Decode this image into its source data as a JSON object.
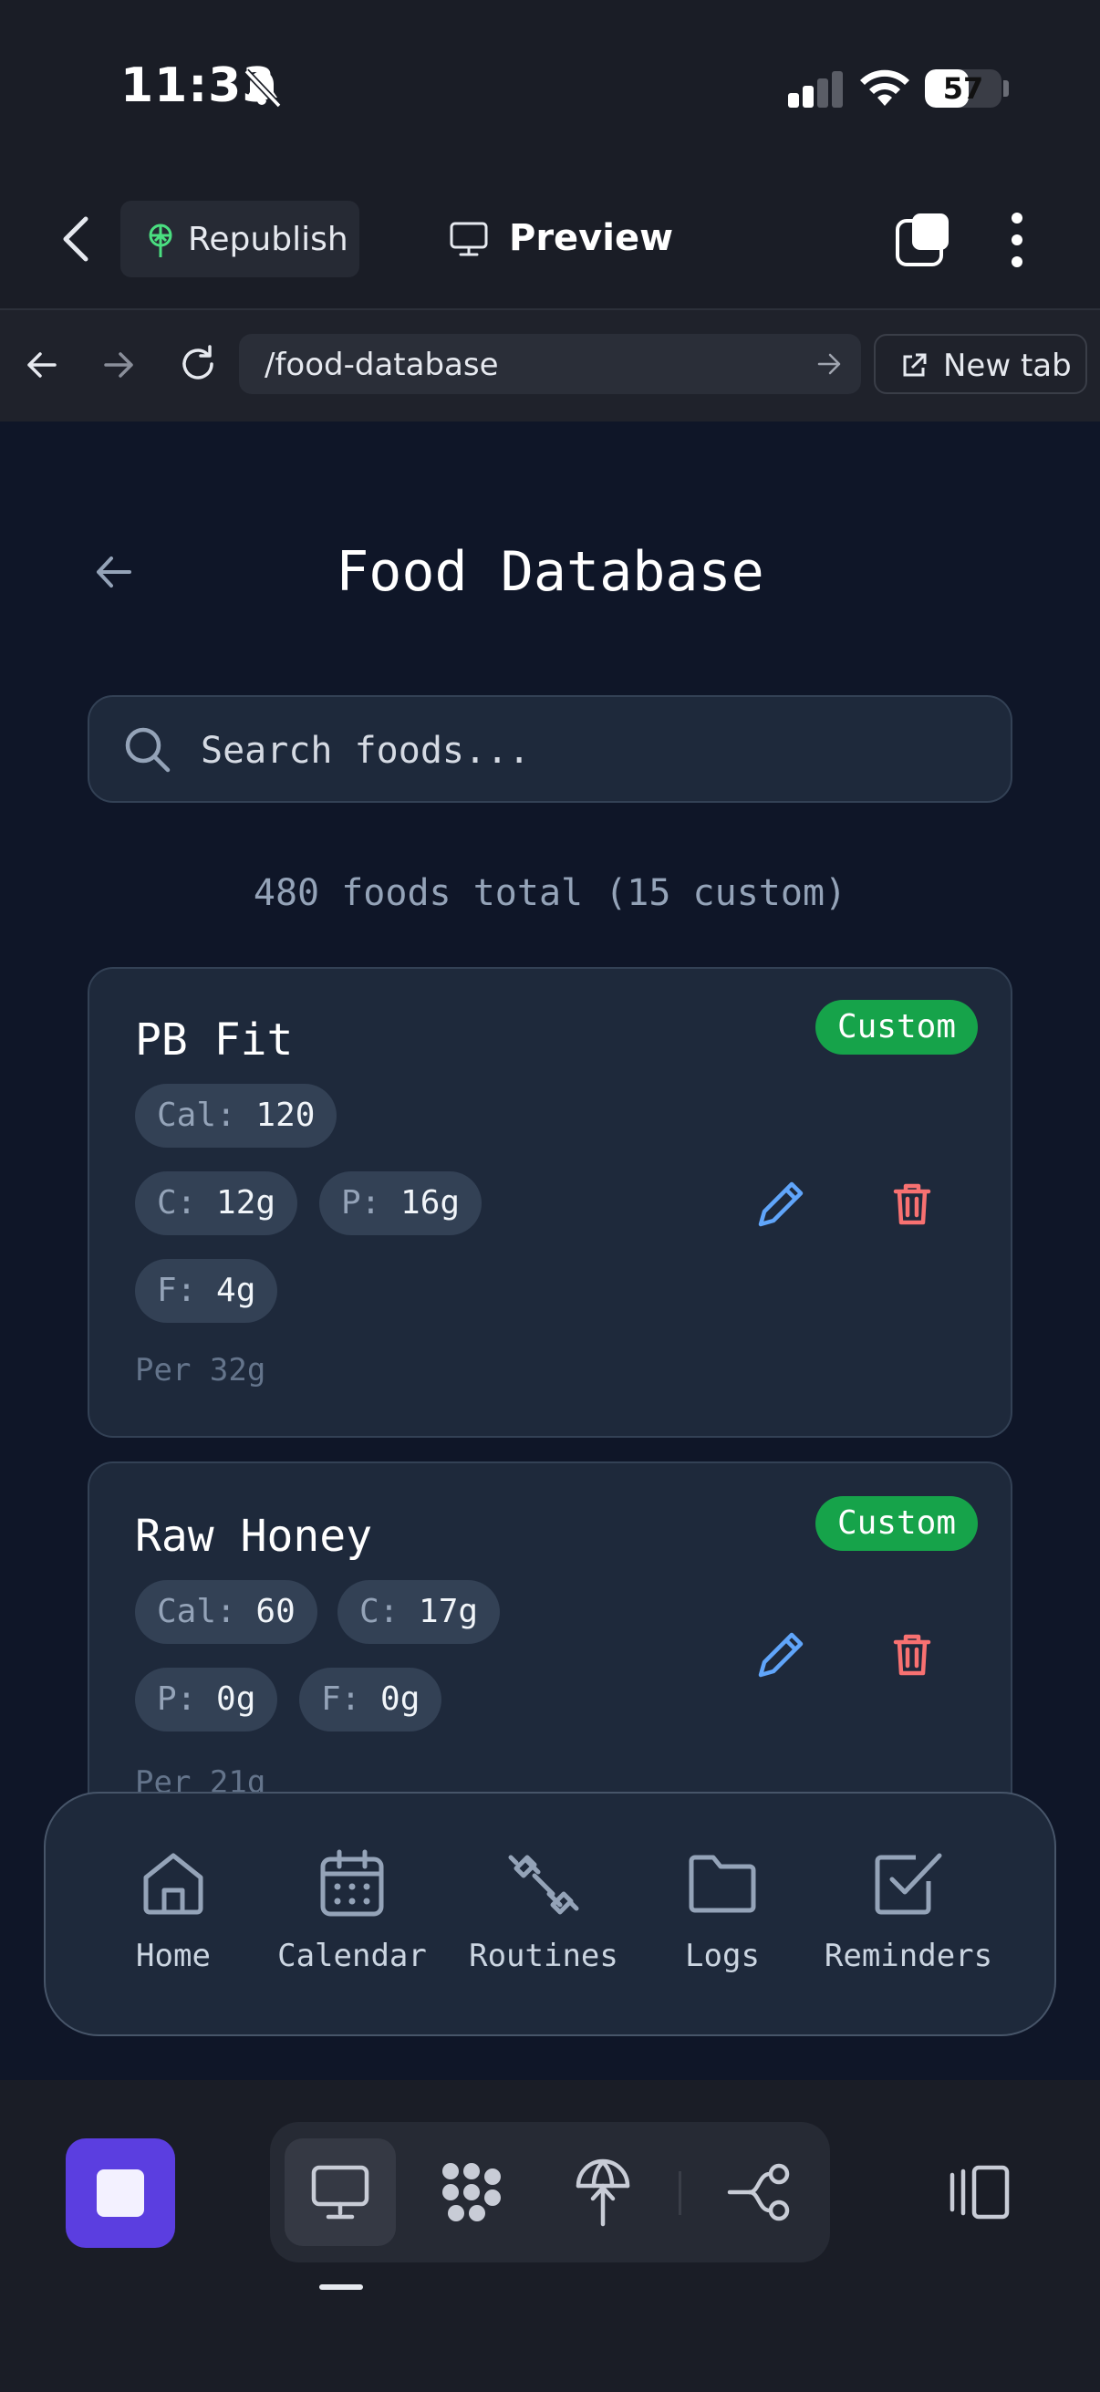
{
  "status_bar": {
    "time": "11:33",
    "battery": "57",
    "battery_level": 0.57,
    "signal_bars_active": 2
  },
  "header": {
    "republish_label": "Republish",
    "preview_label": "Preview"
  },
  "browser": {
    "url": "/food-database",
    "new_tab_label": "New tab"
  },
  "page": {
    "title": "Food Database",
    "search_placeholder": "Search foods...",
    "count_text": "480 foods total (15 custom)"
  },
  "foods": [
    {
      "name": "PB Fit",
      "badge": "Custom",
      "cal_key": "Cal:",
      "cal": "120",
      "c_key": "C:",
      "c": "12g",
      "p_key": "P:",
      "p": "16g",
      "f_key": "F:",
      "f": "4g",
      "per": "Per 32g"
    },
    {
      "name": "Raw Honey",
      "badge": "Custom",
      "cal_key": "Cal:",
      "cal": "60",
      "c_key": "C:",
      "c": "17g",
      "p_key": "P:",
      "p": "0g",
      "f_key": "F:",
      "f": "0g",
      "per": "Per 21g"
    }
  ],
  "bottom_nav": [
    {
      "label": "Home",
      "icon": "home-icon"
    },
    {
      "label": "Calendar",
      "icon": "calendar-icon"
    },
    {
      "label": "Routines",
      "icon": "dumbbell-icon"
    },
    {
      "label": "Logs",
      "icon": "folder-icon"
    },
    {
      "label": "Reminders",
      "icon": "checkbox-icon"
    }
  ],
  "colors": {
    "accent_green": "#16a34a",
    "edit_blue": "#60a5fa",
    "delete_red": "#f87171",
    "stop_purple": "#5b3ee0",
    "content_bg": "#0f1628",
    "card_bg": "#1e293b"
  }
}
